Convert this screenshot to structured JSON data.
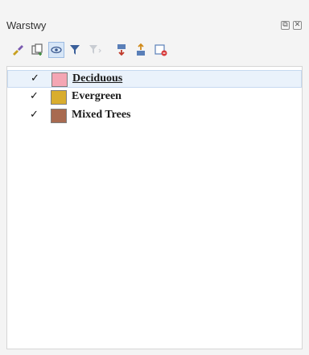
{
  "panel": {
    "title": "Warstwy",
    "float_button": "⧉",
    "close_button": "✕"
  },
  "toolbar": {
    "items": [
      {
        "name": "style-icon"
      },
      {
        "name": "add-group-icon"
      },
      {
        "name": "manage-visibility-icon"
      },
      {
        "name": "filter-legend-icon"
      },
      {
        "name": "filter-by-expression-icon"
      },
      {
        "name": "expand-all-icon"
      },
      {
        "name": "collapse-all-icon"
      },
      {
        "name": "remove-layer-icon"
      }
    ]
  },
  "layers": [
    {
      "label": "Deciduous",
      "checked": "✓",
      "color": "#f4a6b4",
      "selected": true
    },
    {
      "label": "Evergreen",
      "checked": "✓",
      "color": "#d9ad2e",
      "selected": false
    },
    {
      "label": "Mixed Trees",
      "checked": "✓",
      "color": "#a86a50",
      "selected": false
    }
  ]
}
